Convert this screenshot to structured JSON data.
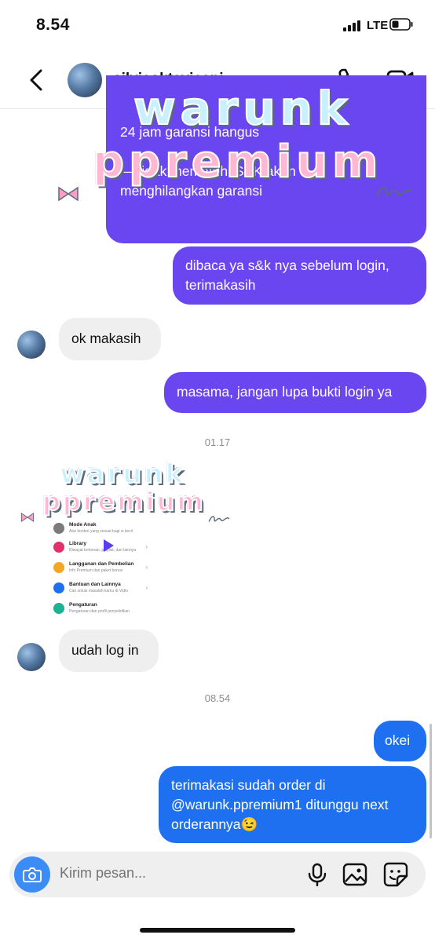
{
  "status_bar": {
    "time": "8.54",
    "network": "LTE"
  },
  "header": {
    "username": "silviaoktaviaani"
  },
  "messages": {
    "cut_off": {
      "lines": [
        "24 jam garansi hangus",
        "— tidak mematuhi S&K akan",
        "menghilangkan garansi"
      ]
    },
    "m1": "dibaca ya s&k nya sebelum login, terimakasih",
    "m2": "ok makasih",
    "m3": "masama, jangan lupa bukti login ya",
    "ts1": "01.17",
    "m4": "udah log in",
    "ts2": "08.54",
    "m5": "okei",
    "m6_line1": "terimakasi sudah order di",
    "m6_line2": "@warunk.ppremium1 ditunggu next",
    "m6_line3": "orderannya😉"
  },
  "stickers": {
    "big_line1": "warunk",
    "big_line2": "ppremium",
    "small_line1": "warunk",
    "small_line2": "ppremium"
  },
  "shared_screenshot": {
    "rows": [
      {
        "title": "Mode Anak",
        "sub": "Atur konten yang sesuai bagi si kecil"
      },
      {
        "title": "Library",
        "sub": "Riwayat tontonan, playlist, dan lainnya"
      },
      {
        "title": "Langganan dan Pembelian",
        "sub": "Info Premium dan paket bonus"
      },
      {
        "title": "Bantuan dan Lainnya",
        "sub": "Cari solusi masalah kamu di Vidio"
      },
      {
        "title": "Pengaturan",
        "sub": "Pengaturan dan profil penyelidikan"
      }
    ],
    "row_colors": [
      "#7b7b7b",
      "#e1306c",
      "#f5a623",
      "#1f70f0",
      "#1ab394"
    ]
  },
  "composer": {
    "placeholder": "Kirim pesan..."
  },
  "colors": {
    "outgoing": "#6946f0",
    "outgoing_blue": "#1f70f0",
    "incoming": "#efefef",
    "camera": "#3b8cf7"
  },
  "icons": [
    "back-icon",
    "phone-call-icon",
    "video-call-icon",
    "camera-icon",
    "microphone-icon",
    "gallery-icon",
    "sticker-icon"
  ]
}
